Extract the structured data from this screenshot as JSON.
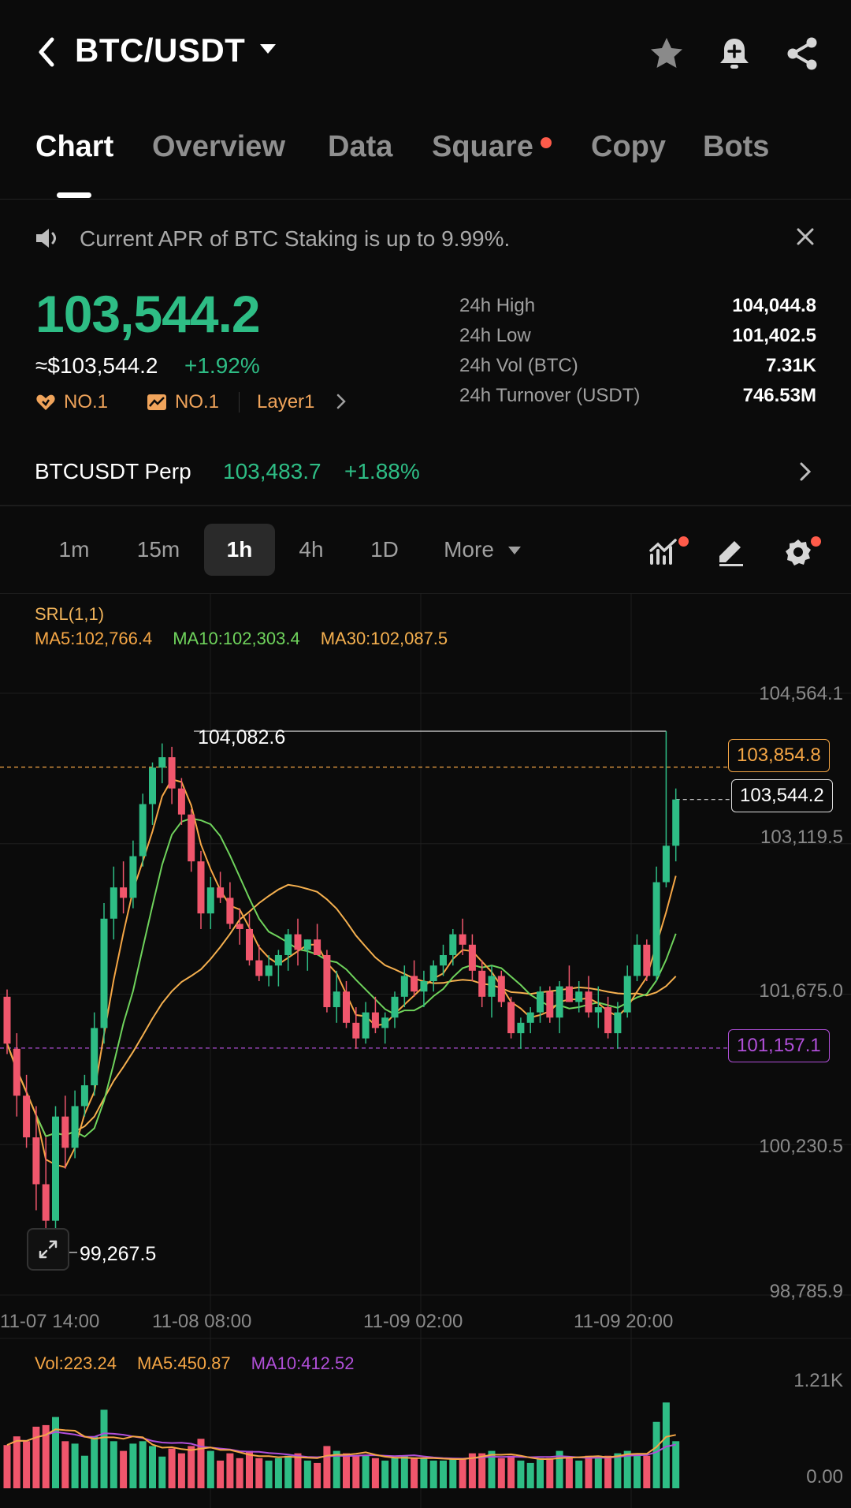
{
  "header": {
    "pair": "BTC/USDT",
    "icons": [
      "back-icon",
      "star-icon",
      "bell-plus-icon",
      "share-icon"
    ]
  },
  "tabs": [
    {
      "label": "Chart",
      "active": true
    },
    {
      "label": "Overview"
    },
    {
      "label": "Data"
    },
    {
      "label": "Square",
      "badge": true
    },
    {
      "label": "Copy"
    },
    {
      "label": "Bots"
    }
  ],
  "notice": {
    "text": "Current APR of BTC Staking is up to 9.99%."
  },
  "ticker": {
    "price": "103,544.2",
    "usd": "≈$103,544.2",
    "change": "+1.92%",
    "tag1": "NO.1",
    "tag2": "NO.1",
    "tag3": "Layer1",
    "stats": [
      {
        "label": "24h High",
        "value": "104,044.8"
      },
      {
        "label": "24h Low",
        "value": "101,402.5"
      },
      {
        "label": "24h Vol (BTC)",
        "value": "7.31K"
      },
      {
        "label": "24h Turnover (USDT)",
        "value": "746.53M"
      }
    ]
  },
  "perp": {
    "label": "BTCUSDT Perp",
    "price": "103,483.7",
    "change": "+1.88%"
  },
  "intervals": [
    {
      "label": "1m"
    },
    {
      "label": "15m"
    },
    {
      "label": "1h",
      "active": true
    },
    {
      "label": "4h"
    },
    {
      "label": "1D"
    },
    {
      "label": "More"
    }
  ],
  "chart": {
    "srl": "SRL(1,1)",
    "ma5": "MA5:102,766.4",
    "ma10": "MA10:102,303.4",
    "ma30": "MA30:102,087.5",
    "y_ticks": [
      "104,564.1",
      "103,119.5",
      "101,675.0",
      "100,230.5",
      "98,785.9"
    ],
    "high_marker": "104,082.6",
    "low_marker": "99,267.5",
    "orange_box": "103,854.8",
    "white_box": "103,544.2",
    "purple_box": "101,157.1",
    "dates": [
      "11-07 14:00",
      "11-08 08:00",
      "11-09 02:00",
      "11-09 20:00"
    ],
    "colors": {
      "up": "#2ebd85",
      "down": "#f0566c",
      "ma5": "#f5a645",
      "ma10": "#6fd35c",
      "ma30": "#f5b04f",
      "purple": "#b04fd8"
    }
  },
  "volume": {
    "vol": "Vol:223.24",
    "ma5": "MA5:450.87",
    "ma10": "MA10:412.52",
    "y_top": "1.21K",
    "y_bottom": "0.00"
  },
  "chart_data": {
    "type": "candlestick",
    "x_labels": [
      "11-07 14:00",
      "11-08 08:00",
      "11-09 02:00",
      "11-09 20:00"
    ],
    "ylim": [
      98785.9,
      104564.1
    ],
    "ohlc": [
      [
        101650,
        101720,
        101100,
        101200
      ],
      [
        101150,
        101300,
        100500,
        100700
      ],
      [
        100700,
        100900,
        100200,
        100300
      ],
      [
        100300,
        100600,
        99600,
        99850
      ],
      [
        99850,
        100300,
        99267.5,
        99500
      ],
      [
        99500,
        100600,
        99400,
        100500
      ],
      [
        100500,
        100700,
        100000,
        100200
      ],
      [
        100200,
        100750,
        100100,
        100600
      ],
      [
        100600,
        100900,
        100500,
        100800
      ],
      [
        100800,
        101500,
        100700,
        101350
      ],
      [
        101350,
        102550,
        101200,
        102400
      ],
      [
        102400,
        102900,
        102200,
        102700
      ],
      [
        102700,
        102950,
        102450,
        102600
      ],
      [
        102600,
        103150,
        102500,
        103000
      ],
      [
        103000,
        103600,
        102900,
        103500
      ],
      [
        103500,
        103900,
        103300,
        103850
      ],
      [
        103850,
        104082.6,
        103700,
        103950
      ],
      [
        103950,
        104050,
        103500,
        103650
      ],
      [
        103650,
        103750,
        103300,
        103400
      ],
      [
        103400,
        103450,
        102850,
        102950
      ],
      [
        102950,
        103050,
        102300,
        102450
      ],
      [
        102450,
        102800,
        102300,
        102700
      ],
      [
        102700,
        102850,
        102550,
        102600
      ],
      [
        102600,
        102750,
        102300,
        102350
      ],
      [
        102350,
        102500,
        102150,
        102300
      ],
      [
        102300,
        102450,
        101950,
        102000
      ],
      [
        102000,
        102150,
        101800,
        101850
      ],
      [
        101850,
        102050,
        101750,
        101950
      ],
      [
        101950,
        102100,
        101750,
        102050
      ],
      [
        102050,
        102300,
        101900,
        102250
      ],
      [
        102250,
        102400,
        101950,
        102100
      ],
      [
        102100,
        102200,
        101900,
        102200
      ],
      [
        102200,
        102350,
        102100,
        102050
      ],
      [
        102050,
        102100,
        101500,
        101550
      ],
      [
        101550,
        101900,
        101400,
        101700
      ],
      [
        101700,
        101800,
        101350,
        101400
      ],
      [
        101400,
        101550,
        101150,
        101250
      ],
      [
        101250,
        101600,
        101200,
        101500
      ],
      [
        101500,
        101650,
        101300,
        101350
      ],
      [
        101350,
        101500,
        101200,
        101450
      ],
      [
        101450,
        101700,
        101350,
        101650
      ],
      [
        101650,
        101950,
        101550,
        101850
      ],
      [
        101850,
        102000,
        101650,
        101700
      ],
      [
        101700,
        101900,
        101550,
        101800
      ],
      [
        101800,
        102000,
        101700,
        101950
      ],
      [
        101950,
        102150,
        101850,
        102050
      ],
      [
        102050,
        102300,
        101950,
        102250
      ],
      [
        102250,
        102400,
        102050,
        102150
      ],
      [
        102150,
        102250,
        101800,
        101900
      ],
      [
        101900,
        102000,
        101550,
        101650
      ],
      [
        101650,
        101950,
        101450,
        101850
      ],
      [
        101850,
        101900,
        101550,
        101600
      ],
      [
        101600,
        101650,
        101250,
        101300
      ],
      [
        101300,
        101450,
        101150,
        101400
      ],
      [
        101400,
        101550,
        101300,
        101500
      ],
      [
        101500,
        101750,
        101400,
        101700
      ],
      [
        101700,
        101750,
        101400,
        101450
      ],
      [
        101450,
        101800,
        101300,
        101750
      ],
      [
        101750,
        101950,
        101600,
        101600
      ],
      [
        101600,
        101800,
        101500,
        101700
      ],
      [
        101700,
        101850,
        101450,
        101500
      ],
      [
        101500,
        101750,
        101350,
        101550
      ],
      [
        101550,
        101650,
        101250,
        101300
      ],
      [
        101300,
        101600,
        101150,
        101500
      ],
      [
        101500,
        101950,
        101450,
        101850
      ],
      [
        101850,
        102250,
        101800,
        102150
      ],
      [
        102150,
        102200,
        101800,
        101850
      ],
      [
        101850,
        102900,
        101800,
        102750
      ],
      [
        102750,
        104200,
        102700,
        103100
      ],
      [
        103100,
        103650,
        102950,
        103544.2
      ]
    ],
    "volume_ylim": [
      0,
      1210
    ]
  }
}
